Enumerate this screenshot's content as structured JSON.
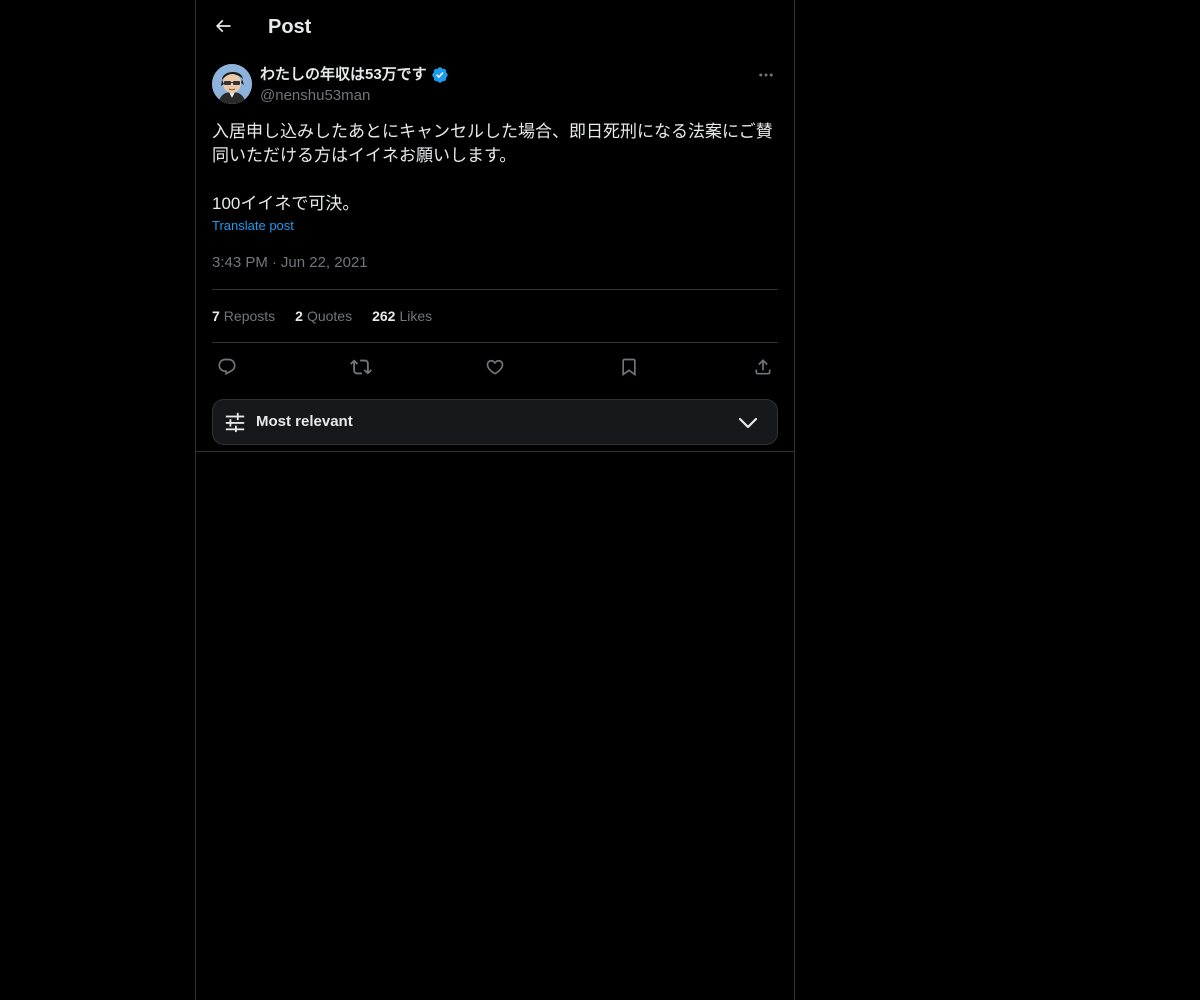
{
  "header": {
    "title": "Post"
  },
  "post": {
    "author": {
      "name": "わたしの年収は53万です",
      "handle": "@nenshu53man",
      "verified": true
    },
    "text": "入居申し込みしたあとにキャンセルした場合、即日死刑になる法案にご賛同いただける方はイイネお願いします。\n\n100イイネで可決。",
    "translate_label": "Translate post",
    "time": "3:43 PM",
    "separator": "·",
    "date": "Jun 22, 2021",
    "stats": {
      "reposts": {
        "count": "7",
        "label": "Reposts"
      },
      "quotes": {
        "count": "2",
        "label": "Quotes"
      },
      "likes": {
        "count": "262",
        "label": "Likes"
      }
    }
  },
  "actions": {
    "icons": [
      "reply-icon",
      "repost-icon",
      "like-icon",
      "bookmark-icon",
      "share-icon"
    ]
  },
  "replies_sort": {
    "label": "Most relevant"
  },
  "colors": {
    "background": "#000000",
    "text_primary": "#e7e9ea",
    "text_secondary": "#71767b",
    "accent": "#1d9bf0",
    "border": "#2f3336",
    "sort_box": "#16181c"
  }
}
